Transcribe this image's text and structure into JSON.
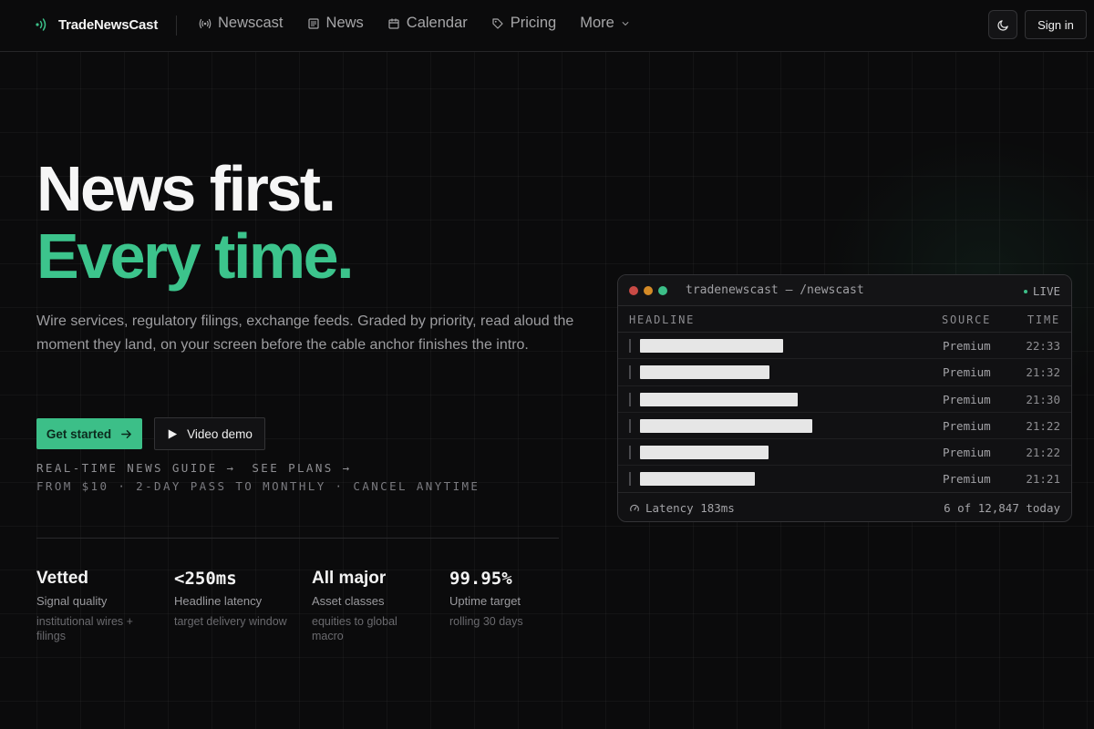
{
  "header": {
    "brand": "TradeNewsCast",
    "nav": [
      {
        "label": "Newscast",
        "icon": "broadcast-icon"
      },
      {
        "label": "News",
        "icon": "newspaper-icon"
      },
      {
        "label": "Calendar",
        "icon": "calendar-icon"
      },
      {
        "label": "Pricing",
        "icon": "tag-icon"
      },
      {
        "label": "More",
        "icon": "chevron-down-icon"
      }
    ],
    "theme_icon": "moon-icon",
    "signin_label": "Sign in"
  },
  "hero": {
    "title_line1": "News first.",
    "title_line2": "Every time.",
    "subtitle": "Wire services, regulatory filings, exchange feeds. Graded by priority, read aloud the moment they land, on your screen before the cable anchor finishes the intro.",
    "cta_primary": "Get started",
    "cta_secondary": "Video demo",
    "link_guide": "REAL-TIME NEWS GUIDE →",
    "link_plans": "SEE PLANS →",
    "pricing_line": "FROM $10 · 2-DAY PASS TO MONTHLY · CANCEL ANYTIME",
    "accent": "#3cbf88"
  },
  "stats": [
    {
      "value": "Vetted",
      "label": "Signal quality",
      "note": "institutional wires + filings"
    },
    {
      "value": "<250ms",
      "label": "Headline latency",
      "note": "target delivery window"
    },
    {
      "value": "All major",
      "label": "Asset classes",
      "note": "equities to global macro"
    },
    {
      "value": "99.95%",
      "label": "Uptime target",
      "note": "rolling 30 days"
    }
  ],
  "terminal": {
    "title": "tradenewscast — /newscast",
    "live_label": "LIVE",
    "columns": {
      "headline": "HEADLINE",
      "source": "SOURCE",
      "time": "TIME"
    },
    "rows": [
      {
        "source": "Premium",
        "time": "22:33",
        "headline_redacted": true
      },
      {
        "source": "Premium",
        "time": "21:32",
        "headline_redacted": true
      },
      {
        "source": "Premium",
        "time": "21:30",
        "headline_redacted": true
      },
      {
        "source": "Premium",
        "time": "21:22",
        "headline_redacted": true
      },
      {
        "source": "Premium",
        "time": "21:22",
        "headline_redacted": true
      },
      {
        "source": "Premium",
        "time": "21:21",
        "headline_redacted": true
      }
    ],
    "latency": "Latency 183ms",
    "count": "6 of 12,847 today",
    "dot_colors": [
      "#d9534f",
      "#e0a030",
      "#3cbf88"
    ]
  }
}
